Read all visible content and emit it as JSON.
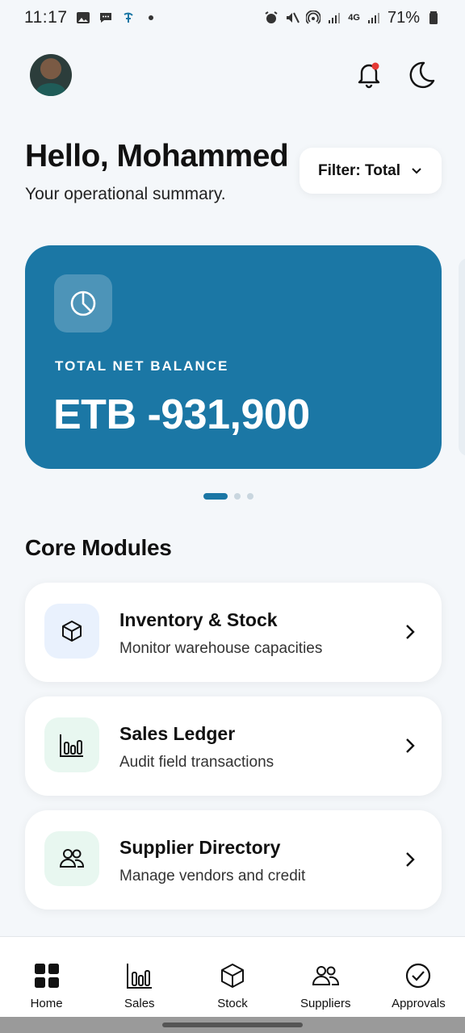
{
  "status_bar": {
    "time": "11:17",
    "battery": "71%",
    "network": "4G"
  },
  "header": {
    "greeting": "Hello, Mohammed",
    "subtitle": "Your operational summary.",
    "filter_label": "Filter: Total"
  },
  "balance_card": {
    "label": "TOTAL NET BALANCE",
    "value": "ETB -931,900",
    "accent_color": "#1b77a5"
  },
  "carousel": {
    "pages": 3,
    "active_index": 0
  },
  "core_modules": {
    "title": "Core Modules",
    "items": [
      {
        "title": "Inventory & Stock",
        "subtitle": "Monitor warehouse capacities",
        "icon": "box-icon",
        "icon_bg": "#e9f1fd"
      },
      {
        "title": "Sales Ledger",
        "subtitle": "Audit field transactions",
        "icon": "bar-chart-icon",
        "icon_bg": "#e8f7f0"
      },
      {
        "title": "Supplier Directory",
        "subtitle": "Manage vendors and credit",
        "icon": "users-icon",
        "icon_bg": "#e8f7f0"
      }
    ]
  },
  "bottom_nav": {
    "items": [
      {
        "label": "Home",
        "icon": "grid-icon"
      },
      {
        "label": "Sales",
        "icon": "bar-chart-icon"
      },
      {
        "label": "Stock",
        "icon": "box-icon"
      },
      {
        "label": "Suppliers",
        "icon": "users-icon"
      },
      {
        "label": "Approvals",
        "icon": "check-circle-icon"
      }
    ]
  }
}
